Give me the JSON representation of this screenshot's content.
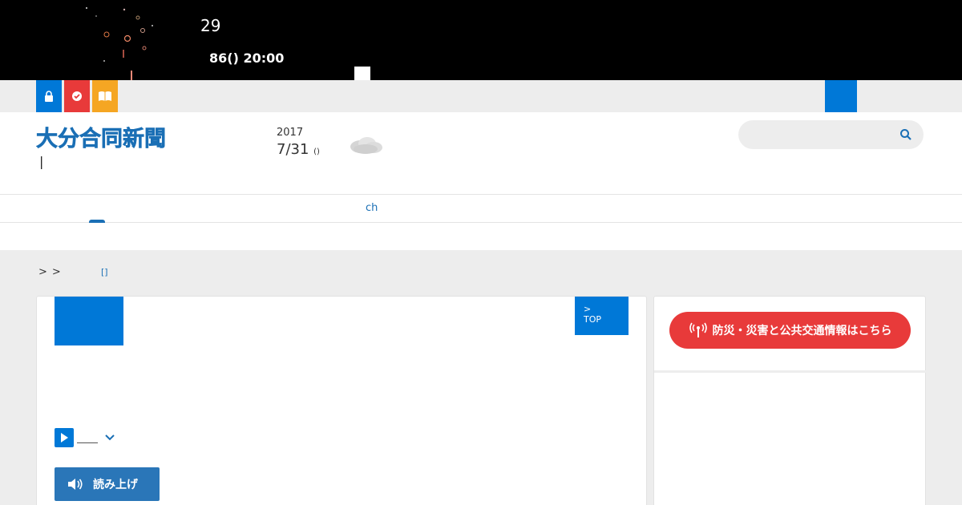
{
  "banner": {
    "headline": "29",
    "subline": "86() 20:00"
  },
  "utility": {
    "icons": [
      "lock-icon",
      "check-icon",
      "book-icon"
    ],
    "colors": {
      "blue": "#0078d7",
      "red": "#e83a3a",
      "orange": "#f5a623"
    }
  },
  "header": {
    "logo_text": "大分合同新聞",
    "pipe": "|",
    "year": "2017",
    "month_day": "7/31",
    "weekday": "()",
    "weather_icon": "cloudy-icon",
    "search_placeholder": ""
  },
  "nav": {
    "item_ch": "ch"
  },
  "breadcrumb": {
    "sep1": ">",
    "sep2": ">",
    "link": "[]"
  },
  "article": {
    "top_tag_line1": ">",
    "top_tag_line2": "TOP",
    "read_aloud": "読み上げ"
  },
  "sidebar": {
    "disaster_button": "防災・災害と公共交通情報はこちら"
  }
}
